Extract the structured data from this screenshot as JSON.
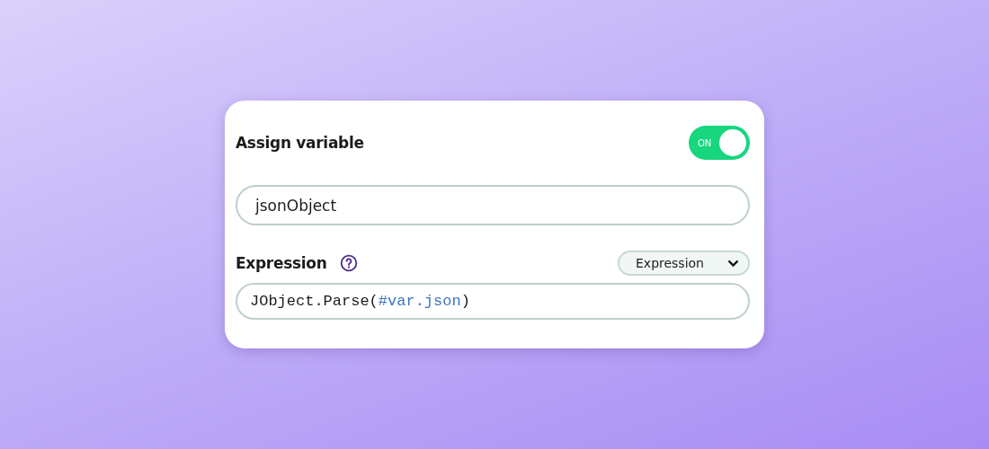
{
  "card": {
    "title": "Assign variable",
    "toggle": {
      "label": "ON",
      "on": true
    },
    "variable_field": {
      "value": "jsonObject"
    },
    "expression": {
      "label": "Expression",
      "mode_dropdown": {
        "value": "Expression"
      },
      "code": [
        {
          "kind": "plain",
          "text": "JObject.Parse("
        },
        {
          "kind": "variable",
          "text": "#var.json"
        },
        {
          "kind": "plain",
          "text": ")"
        }
      ]
    }
  }
}
